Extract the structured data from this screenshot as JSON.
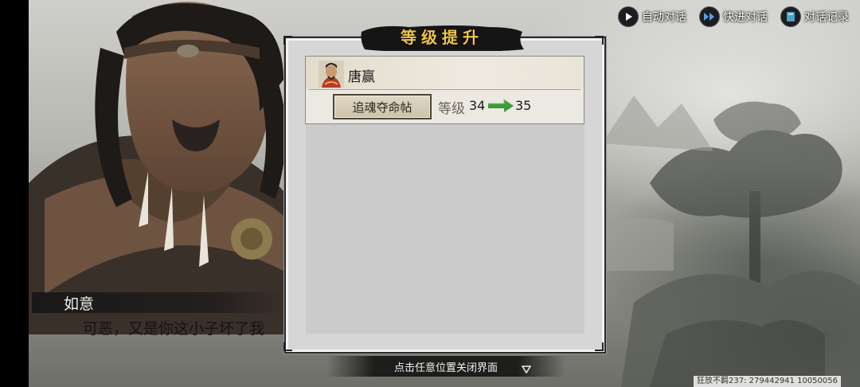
{
  "controls": {
    "auto_label": "自动对话",
    "fast_label": "快进对话",
    "log_label": "对话记录"
  },
  "dialogue": {
    "speaker": "如意",
    "text": "可恶，又是你这小子坏了我"
  },
  "modal": {
    "title": "等级提升",
    "character_name": "唐赢",
    "item_button": "追魂夺命帖",
    "level_label": "等级",
    "level_from": "34",
    "level_to": "35"
  },
  "footer": {
    "close_hint": "点击任意位置关闭界面"
  },
  "watermark": "狂放不羁237: 279442941  10050056",
  "colors": {
    "title_gold": "#f0c545",
    "arrow_green": "#3f9a3a"
  }
}
